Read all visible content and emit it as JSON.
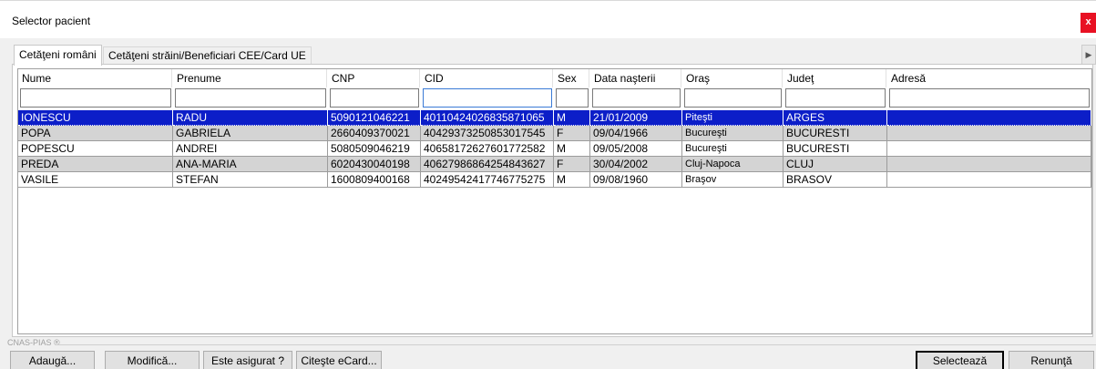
{
  "window": {
    "title": "Selector pacient",
    "close_label": "x"
  },
  "tabs": [
    {
      "label": "Cetăţeni români"
    },
    {
      "label": "Cetăţeni străini/Beneficiari CEE/Card UE"
    }
  ],
  "scroll_arrow": "▶",
  "grid": {
    "columns": [
      "Nume",
      "Prenume",
      "CNP",
      "CID",
      "Sex",
      "Data naşterii",
      "Oraş",
      "Judeţ",
      "Adresă"
    ],
    "rows": [
      [
        "IONESCU",
        "RADU",
        "5090121046221",
        "40110424026835871065",
        "M",
        "21/01/2009",
        "Piteşti",
        "ARGES",
        ""
      ],
      [
        "POPA",
        "GABRIELA",
        "2660409370021",
        "40429373250853017545",
        "F",
        "09/04/1966",
        "Bucureşti",
        "BUCURESTI",
        ""
      ],
      [
        "POPESCU",
        "ANDREI",
        "5080509046219",
        "40658172627601772582",
        "M",
        "09/05/2008",
        "Bucureşti",
        "BUCURESTI",
        ""
      ],
      [
        "PREDA",
        "ANA-MARIA",
        "6020430040198",
        "40627986864254843627",
        "F",
        "30/04/2002",
        "Cluj-Napoca",
        "CLUJ",
        ""
      ],
      [
        "VASILE",
        "STEFAN",
        "1600809400168",
        "40249542417746775275",
        "M",
        "09/08/1960",
        "Braşov",
        "BRASOV",
        ""
      ]
    ]
  },
  "footer": {
    "brand": "CNAS-PIAS ®",
    "buttons": {
      "add": "Adaugă...",
      "modify": "Modifică...",
      "insured": "Este asigurat ?",
      "read_ecard": "Citeşte eCard...",
      "select": "Selectează",
      "cancel": "Renunţă"
    }
  },
  "colors": {
    "selection": "#0c1ec8",
    "alt_row": "#d4d4d4",
    "close": "#e81123"
  }
}
